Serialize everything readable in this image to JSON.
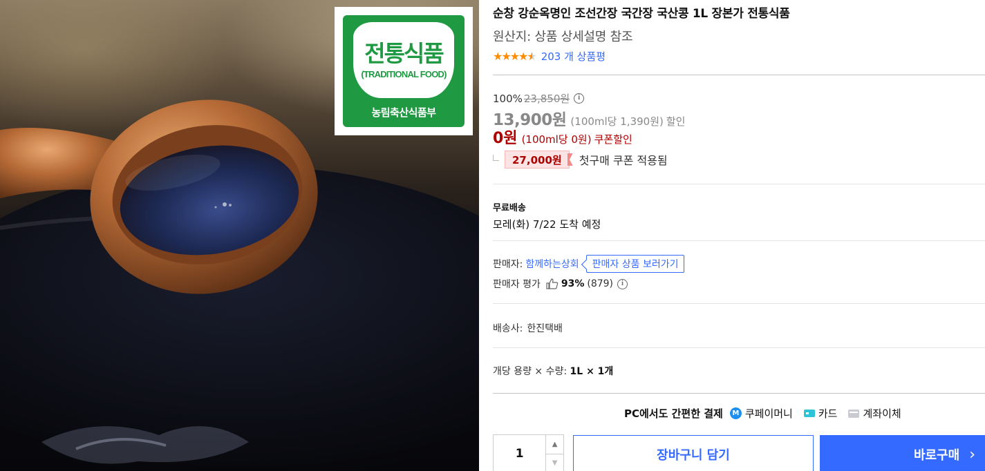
{
  "badge": {
    "title": "전통식품",
    "subtitle": "(TRADITIONAL FOOD)",
    "ministry": "농림축산식품부"
  },
  "product": {
    "title": "순창 강순옥명인 조선간장 국간장 국산콩 1L 장본가 전통식품",
    "origin": "원산지: 상품 상세설명 참조",
    "rating": 4.5,
    "review_count": "203 개 상품평"
  },
  "price": {
    "discount_rate": "100%",
    "original_price": "23,850원",
    "info_icon": "info-icon",
    "sale_price": "13,900원",
    "sale_unit_price": "(100ml당 1,390원)",
    "sale_label": "할인",
    "coupon_price": "0원",
    "coupon_unit_price": "(100ml당 0원)",
    "coupon_label": "쿠폰할인",
    "first_coupon_amount": "27,000원",
    "first_coupon_text": "첫구매 쿠폰 적용됨"
  },
  "shipping": {
    "free_label": "무료배송",
    "arrival": "모레(화) 7/22 도착 예정"
  },
  "seller": {
    "label": "판매자:",
    "name": "함께하는상회",
    "link_label": "판매자 상품 보러가기",
    "rating_label": "판매자 평가",
    "rating_pct": "93%",
    "rating_count": "(879)"
  },
  "delivery": {
    "carrier_label": "배송사:",
    "carrier": "한진택배"
  },
  "quantity_info": {
    "label": "개당 용량 × 수량:",
    "value": "1L × 1개"
  },
  "payment": {
    "label": "PC에서도 간편한 결제",
    "methods": [
      "쿠페이머니",
      "카드",
      "계좌이체"
    ]
  },
  "purchase": {
    "quantity": "1",
    "cart_label": "장바구니 담기",
    "buy_label": "바로구매"
  },
  "colors": {
    "accent_blue": "#346aff",
    "coupon_red": "#ae0000",
    "star_orange": "#ff8c00",
    "badge_green": "#1f9a42"
  }
}
